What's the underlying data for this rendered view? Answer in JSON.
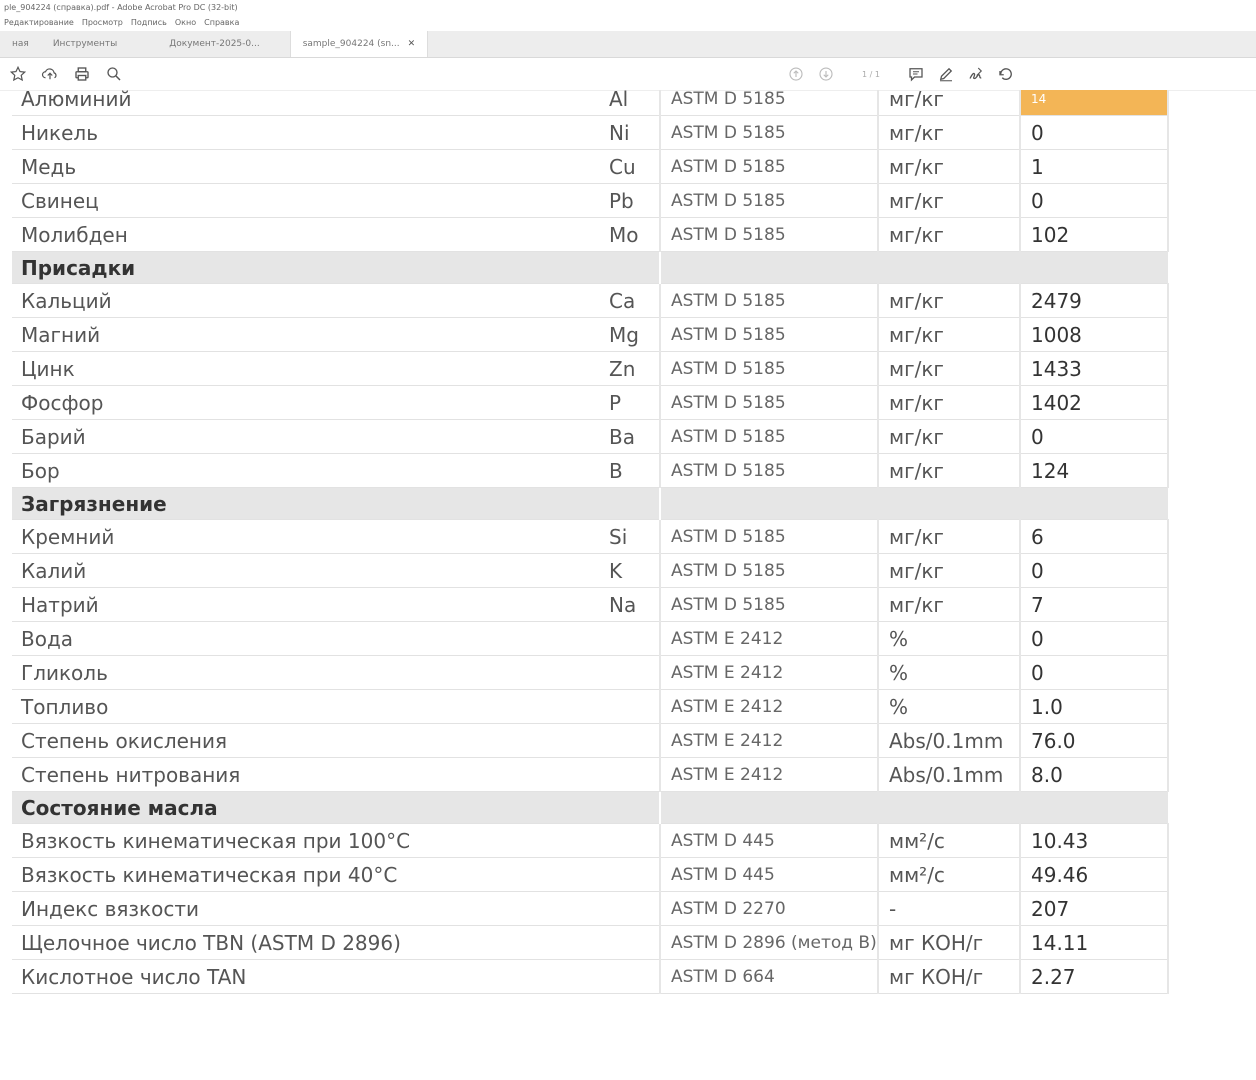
{
  "window": {
    "title": "ple_904224 (справка).pdf - Adobe Acrobat Pro DC (32-bit)",
    "menu": [
      "Редактирование",
      "Просмотр",
      "Подпись",
      "Окно",
      "Справка"
    ]
  },
  "tabs": [
    {
      "label": "ная"
    },
    {
      "label": "Инструменты"
    },
    {
      "label": "Документ-2025-0..."
    },
    {
      "label": "sample_904224 (sn..."
    }
  ],
  "toolbar": {
    "left_icons": [
      "star-icon",
      "upload-icon",
      "print-icon",
      "search-icon"
    ],
    "page": "1 / 1",
    "right_icons": [
      "prev-page-icon",
      "next-page-icon",
      "comment-icon",
      "pen-icon",
      "sign-icon",
      "share-icon"
    ]
  },
  "table": {
    "rows": [
      {
        "name": "Алюминий",
        "sym": "Al",
        "method": "ASTM D 5185",
        "unit": "мг/кг",
        "value": "14",
        "highlight": true
      },
      {
        "name": "Никель",
        "sym": "Ni",
        "method": "ASTM D 5185",
        "unit": "мг/кг",
        "value": "0"
      },
      {
        "name": "Медь",
        "sym": "Cu",
        "method": "ASTM D 5185",
        "unit": "мг/кг",
        "value": "1"
      },
      {
        "name": "Свинец",
        "sym": "Pb",
        "method": "ASTM D 5185",
        "unit": "мг/кг",
        "value": "0"
      },
      {
        "name": "Молибден",
        "sym": "Mo",
        "method": "ASTM D 5185",
        "unit": "мг/кг",
        "value": "102"
      },
      {
        "section": "Присадки"
      },
      {
        "name": "Кальций",
        "sym": "Ca",
        "method": "ASTM D 5185",
        "unit": "мг/кг",
        "value": "2479"
      },
      {
        "name": "Магний",
        "sym": "Mg",
        "method": "ASTM D 5185",
        "unit": "мг/кг",
        "value": "1008"
      },
      {
        "name": "Цинк",
        "sym": "Zn",
        "method": "ASTM D 5185",
        "unit": "мг/кг",
        "value": "1433"
      },
      {
        "name": "Фосфор",
        "sym": "P",
        "method": "ASTM D 5185",
        "unit": "мг/кг",
        "value": "1402"
      },
      {
        "name": "Барий",
        "sym": "Ba",
        "method": "ASTM D 5185",
        "unit": "мг/кг",
        "value": "0"
      },
      {
        "name": "Бор",
        "sym": "B",
        "method": "ASTM D 5185",
        "unit": "мг/кг",
        "value": "124"
      },
      {
        "section": "Загрязнение"
      },
      {
        "name": "Кремний",
        "sym": "Si",
        "method": "ASTM D 5185",
        "unit": "мг/кг",
        "value": "6"
      },
      {
        "name": "Калий",
        "sym": "K",
        "method": "ASTM D 5185",
        "unit": "мг/кг",
        "value": "0"
      },
      {
        "name": "Натрий",
        "sym": "Na",
        "method": "ASTM D 5185",
        "unit": "мг/кг",
        "value": "7"
      },
      {
        "name": "Вода",
        "sym": "",
        "method": "ASTM E 2412",
        "unit": "%",
        "value": "0"
      },
      {
        "name": "Гликоль",
        "sym": "",
        "method": "ASTM E 2412",
        "unit": "%",
        "value": "0"
      },
      {
        "name": "Топливо",
        "sym": "",
        "method": "ASTM E 2412",
        "unit": "%",
        "value": "1.0"
      },
      {
        "name": "Степень окисления",
        "sym": "",
        "method": "ASTM E 2412",
        "unit": "Abs/0.1mm",
        "value": "76.0"
      },
      {
        "name": "Степень нитрования",
        "sym": "",
        "method": "ASTM E 2412",
        "unit": "Abs/0.1mm",
        "value": "8.0"
      },
      {
        "section": "Состояние масла"
      },
      {
        "name": "Вязкость кинематическая при 100°С",
        "sym": "",
        "method": "ASTM D 445",
        "unit": "мм²/с",
        "value": "10.43"
      },
      {
        "name": "Вязкость кинематическая при 40°С",
        "sym": "",
        "method": "ASTM D 445",
        "unit": "мм²/с",
        "value": "49.46"
      },
      {
        "name": "Индекс вязкости",
        "sym": "",
        "method": "ASTM D 2270",
        "unit": "-",
        "value": "207"
      },
      {
        "name": "Щелочное число TBN (ASTM D 2896)",
        "sym": "",
        "method": "ASTM D 2896 (метод B)",
        "unit": "мг КОН/г",
        "value": "14.11"
      },
      {
        "name": "Кислотное число TAN",
        "sym": "",
        "method": "ASTM D 664",
        "unit": "мг КОН/г",
        "value": "2.27"
      }
    ]
  }
}
